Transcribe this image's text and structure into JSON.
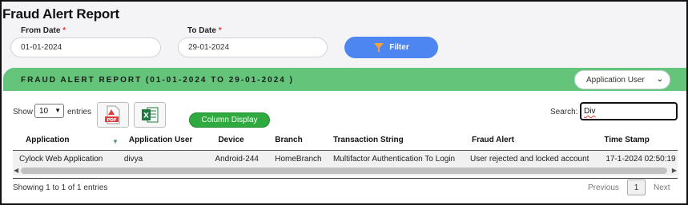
{
  "page": {
    "title": "Fraud Alert Report"
  },
  "filters": {
    "from_label": "From Date",
    "to_label": "To Date",
    "required_mark": "*",
    "from_value": "01-01-2024",
    "to_value": "29-01-2024",
    "filter_button": "Filter"
  },
  "report_bar": {
    "title": "FRAUD ALERT REPORT (01-01-2024 TO 29-01-2024 )",
    "view_select": "Application User"
  },
  "controls": {
    "show_label": "Show",
    "entries_value": "10",
    "entries_label": "entries",
    "pdf_label": "PDF",
    "excel_label": "X",
    "column_display": "Column Display",
    "search_label": "Search:",
    "search_value": "Div"
  },
  "table": {
    "headers": [
      "Application",
      "Application User",
      "Device",
      "Branch",
      "Transaction String",
      "Fraud Alert",
      "Time Stamp"
    ],
    "rows": [
      [
        "Cylock Web Application",
        "divya",
        "Android-244",
        "HomeBranch",
        "Multifactor Authentication To Login",
        "User rejected and locked account",
        "17-1-2024 02:50:19"
      ]
    ]
  },
  "footer": {
    "info": "Showing 1 to 1 of 1 entries",
    "previous": "Previous",
    "current_page": "1",
    "next": "Next"
  },
  "colors": {
    "accent_green": "#63c47a",
    "filter_blue": "#4d86f0",
    "button_green": "#2faa3f"
  }
}
